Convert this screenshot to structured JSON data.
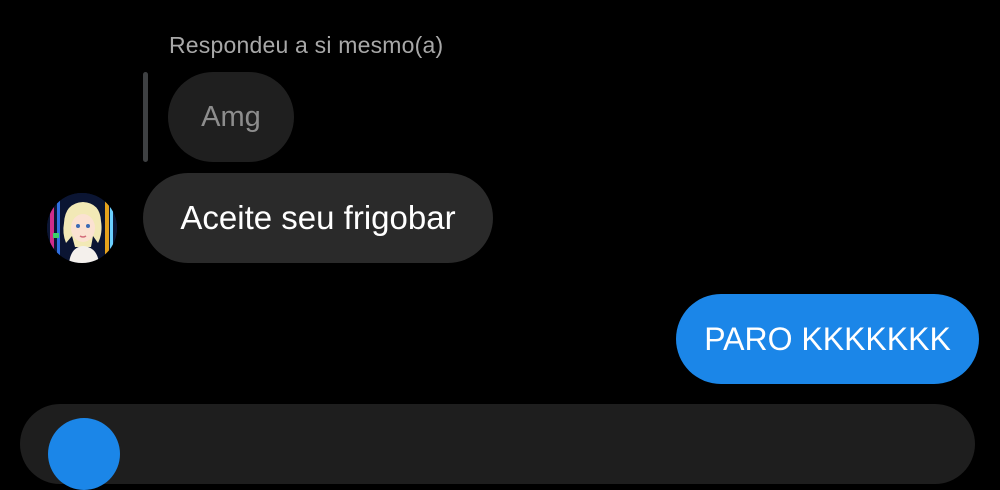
{
  "conversation": {
    "reply_context": {
      "label": "Respondeu a si mesmo(a)",
      "quoted_text": "Amg"
    },
    "messages": [
      {
        "direction": "received",
        "text": "Aceite seu frigobar",
        "has_avatar": true
      },
      {
        "direction": "sent",
        "text": "PARO KKKKKKK"
      }
    ]
  },
  "colors": {
    "background": "#000000",
    "received_bubble": "#2a2a2a",
    "sent_bubble": "#1b86e8",
    "reply_text": "#a8a8a8"
  },
  "icons": {
    "avatar": "profile-avatar-icon",
    "composer_button": "composer-action-icon"
  }
}
